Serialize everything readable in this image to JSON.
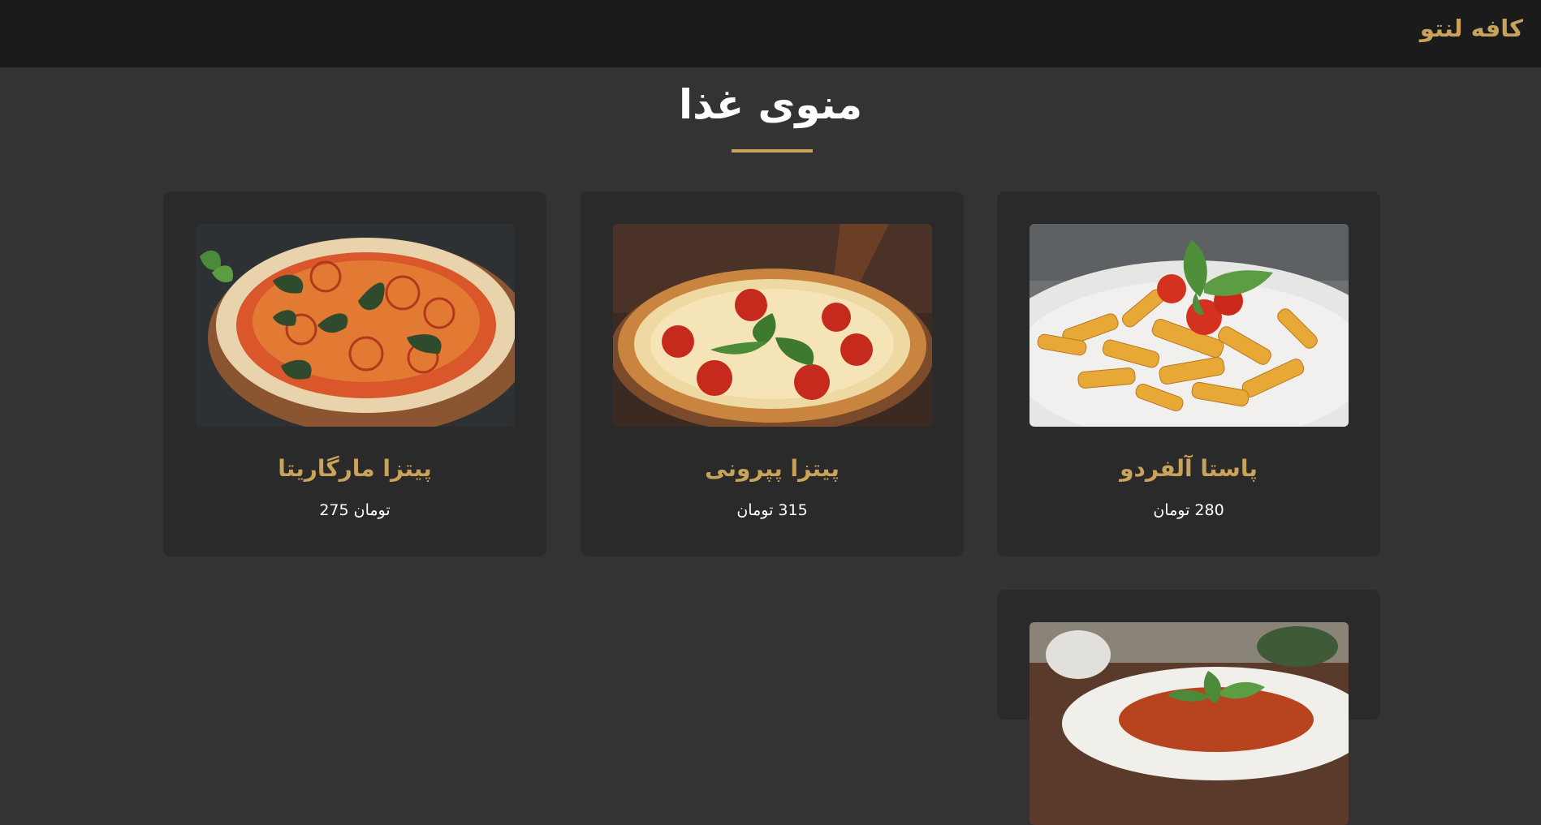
{
  "header": {
    "brand": "کافه لنتو"
  },
  "menu": {
    "title": "منوی غذا",
    "accent_color": "#c9a35c",
    "items": [
      {
        "name": "پاستا آلفردو",
        "price": "280 تومان",
        "image": "pasta-photo"
      },
      {
        "name": "پیتزا پپرونی",
        "price": "315 تومان",
        "image": "pepperoni-pizza-photo"
      },
      {
        "name": "پیتزا مارگاریتا",
        "price": "تومان 275",
        "image": "margherita-pizza-photo"
      },
      {
        "name": "",
        "price": "",
        "image": "pasta-bolognese-photo"
      }
    ]
  }
}
